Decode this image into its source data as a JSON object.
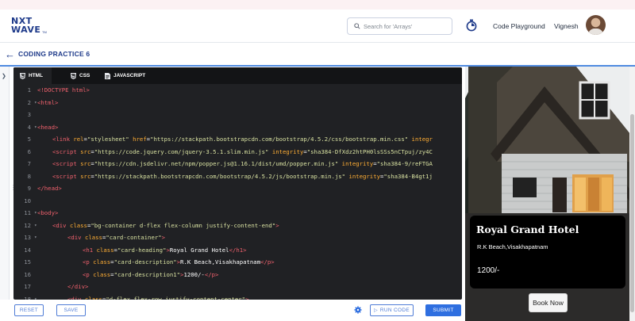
{
  "header": {
    "logo_line1": "NXT",
    "logo_line2": "WAVE",
    "logo_tm": "TM",
    "search_placeholder": "Search for 'Arrays'",
    "code_playground": "Code Playground",
    "user_name": "Vignesh"
  },
  "page": {
    "title": "CODING PRACTICE 6"
  },
  "editor": {
    "tabs": [
      {
        "label": "HTML",
        "active": true
      },
      {
        "label": "CSS",
        "active": false
      },
      {
        "label": "JAVASCRIPT",
        "active": false
      }
    ],
    "lines": [
      {
        "n": "1",
        "fold": "",
        "indent": 0,
        "tokens": [
          [
            "tag",
            "<!DOCTYPE html>"
          ]
        ]
      },
      {
        "n": "2",
        "fold": "▾",
        "indent": 0,
        "tokens": [
          [
            "tag",
            "<html>"
          ]
        ]
      },
      {
        "n": "3",
        "fold": "",
        "indent": 0,
        "tokens": []
      },
      {
        "n": "4",
        "fold": "▾",
        "indent": 0,
        "tokens": [
          [
            "tag",
            "<head>"
          ]
        ]
      },
      {
        "n": "5",
        "fold": "",
        "indent": 1,
        "tokens": [
          [
            "tag",
            "<link "
          ],
          [
            "attr",
            "rel"
          ],
          [
            "txt",
            "="
          ],
          [
            "str",
            "\"stylesheet\" "
          ],
          [
            "attr",
            "href"
          ],
          [
            "txt",
            "="
          ],
          [
            "str",
            "\"https://stackpath.bootstrapcdn.com/bootstrap/4.5.2/css/bootstrap.min.css\" "
          ],
          [
            "attr",
            "integr"
          ]
        ]
      },
      {
        "n": "6",
        "fold": "",
        "indent": 1,
        "tokens": [
          [
            "tag",
            "<script "
          ],
          [
            "attr",
            "src"
          ],
          [
            "txt",
            "="
          ],
          [
            "str",
            "\"https://code.jquery.com/jquery-3.5.1.slim.min.js\" "
          ],
          [
            "attr",
            "integrity"
          ],
          [
            "txt",
            "="
          ],
          [
            "str",
            "\"sha384-DfXdz2htPH0lsSSs5nCTpuj/zy4C"
          ]
        ]
      },
      {
        "n": "7",
        "fold": "",
        "indent": 1,
        "tokens": [
          [
            "tag",
            "<script "
          ],
          [
            "attr",
            "src"
          ],
          [
            "txt",
            "="
          ],
          [
            "str",
            "\"https://cdn.jsdelivr.net/npm/popper.js@1.16.1/dist/umd/popper.min.js\" "
          ],
          [
            "attr",
            "integrity"
          ],
          [
            "txt",
            "="
          ],
          [
            "str",
            "\"sha384-9/reFTGA"
          ]
        ]
      },
      {
        "n": "8",
        "fold": "",
        "indent": 1,
        "tokens": [
          [
            "tag",
            "<script "
          ],
          [
            "attr",
            "src"
          ],
          [
            "txt",
            "="
          ],
          [
            "str",
            "\"https://stackpath.bootstrapcdn.com/bootstrap/4.5.2/js/bootstrap.min.js\" "
          ],
          [
            "attr",
            "integrity"
          ],
          [
            "txt",
            "="
          ],
          [
            "str",
            "\"sha384-B4gt1j"
          ]
        ]
      },
      {
        "n": "9",
        "fold": "",
        "indent": 0,
        "tokens": [
          [
            "tag",
            "</head>"
          ]
        ]
      },
      {
        "n": "10",
        "fold": "",
        "indent": 0,
        "tokens": []
      },
      {
        "n": "11",
        "fold": "▾",
        "indent": 0,
        "tokens": [
          [
            "tag",
            "<body>"
          ]
        ]
      },
      {
        "n": "12",
        "fold": "▾",
        "indent": 1,
        "tokens": [
          [
            "tag",
            "<div "
          ],
          [
            "attr",
            "class"
          ],
          [
            "txt",
            "="
          ],
          [
            "str",
            "\"bg-container d-flex flex-column justify-content-end\""
          ],
          [
            "tag",
            ">"
          ]
        ]
      },
      {
        "n": "13",
        "fold": "▾",
        "indent": 2,
        "tokens": [
          [
            "tag",
            "<div "
          ],
          [
            "attr",
            "class"
          ],
          [
            "txt",
            "="
          ],
          [
            "str",
            "\"card-container\""
          ],
          [
            "tag",
            ">"
          ]
        ]
      },
      {
        "n": "14",
        "fold": "",
        "indent": 3,
        "tokens": [
          [
            "tag",
            "<h1 "
          ],
          [
            "attr",
            "class"
          ],
          [
            "txt",
            "="
          ],
          [
            "str",
            "\"card-heading\""
          ],
          [
            "tag",
            ">"
          ],
          [
            "txt",
            "Royal Grand Hotel"
          ],
          [
            "tag",
            "</h1>"
          ]
        ]
      },
      {
        "n": "15",
        "fold": "",
        "indent": 3,
        "tokens": [
          [
            "tag",
            "<p "
          ],
          [
            "attr",
            "class"
          ],
          [
            "txt",
            "="
          ],
          [
            "str",
            "\"card-description\""
          ],
          [
            "tag",
            ">"
          ],
          [
            "txt",
            "R.K Beach,Visakhapatnam"
          ],
          [
            "tag",
            "</p>"
          ]
        ]
      },
      {
        "n": "16",
        "fold": "",
        "indent": 3,
        "tokens": [
          [
            "tag",
            "<p "
          ],
          [
            "attr",
            "class"
          ],
          [
            "txt",
            "="
          ],
          [
            "str",
            "\"card-description1\""
          ],
          [
            "tag",
            ">"
          ],
          [
            "txt",
            "1200/-"
          ],
          [
            "tag",
            "</p>"
          ]
        ]
      },
      {
        "n": "17",
        "fold": "",
        "indent": 2,
        "tokens": [
          [
            "tag",
            "</div>"
          ]
        ]
      },
      {
        "n": "18",
        "fold": "▾",
        "indent": 2,
        "tokens": [
          [
            "tag",
            "<div "
          ],
          [
            "attr",
            "class"
          ],
          [
            "txt",
            "="
          ],
          [
            "str",
            "\"d-flex flex-row justify-content-center\""
          ],
          [
            "tag",
            ">"
          ]
        ]
      }
    ]
  },
  "preview": {
    "card_heading": "Royal Grand Hotel",
    "card_description": "R.K Beach,Visakhapatnam",
    "card_price": "1200/-",
    "book_button": "Book Now"
  },
  "actions": {
    "reset": "RESET",
    "save": "SAVE",
    "run_code": "RUN CODE",
    "submit": "SUBMIT"
  },
  "colors": {
    "brand": "#1e3a8a",
    "accent": "#2f6fe0",
    "editor_bg": "#202124",
    "tag": "#f0616d",
    "attr": "#ffae34",
    "string": "#d7e0a0"
  }
}
